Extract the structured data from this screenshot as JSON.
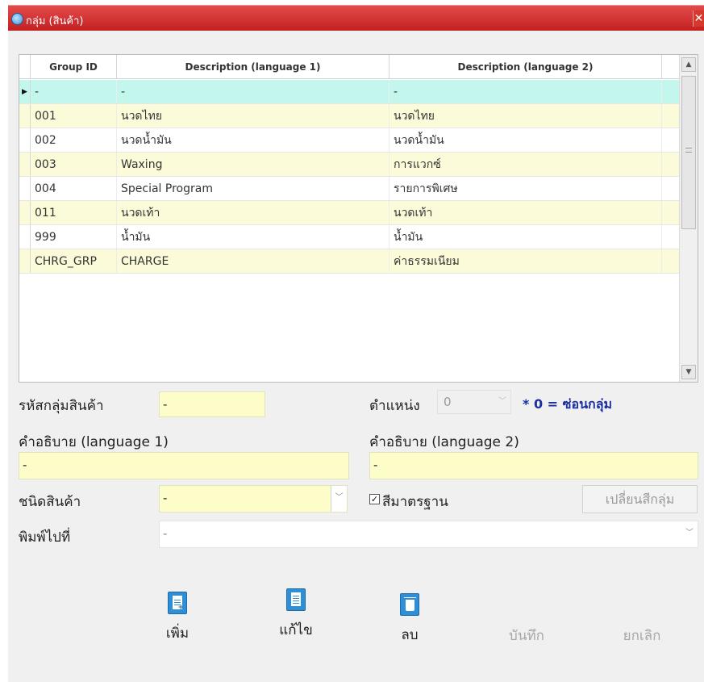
{
  "window": {
    "title": "กลุ่ม (สินค้า)",
    "close_glyph": "✕"
  },
  "grid": {
    "columns": [
      "Group ID",
      "Description (language 1)",
      "Description (language 2)"
    ],
    "current_marker": "▶",
    "rows": [
      {
        "id": "-",
        "d1": "-",
        "d2": "-"
      },
      {
        "id": "001",
        "d1": "นวดไทย",
        "d2": "นวดไทย"
      },
      {
        "id": "002",
        "d1": "นวดน้ำมัน",
        "d2": "นวดน้ำมัน"
      },
      {
        "id": "003",
        "d1": "Waxing",
        "d2": "การแวกซ์"
      },
      {
        "id": "004",
        "d1": "Special Program",
        "d2": "รายการพิเศษ"
      },
      {
        "id": "011",
        "d1": "นวดเท้า",
        "d2": "นวดเท้า"
      },
      {
        "id": "999",
        "d1": "น้ำมัน",
        "d2": "น้ำมัน"
      },
      {
        "id": "CHRG_GRP",
        "d1": "CHARGE",
        "d2": "ค่าธรรมเนียม"
      }
    ]
  },
  "form": {
    "group_code_label": "รหัสกลุ่มสินค้า",
    "group_code_value": "-",
    "position_label": "ตำแหน่ง",
    "position_value": "0",
    "position_note": "* 0 = ซ่อนกลุ่ม",
    "desc1_label": "คำอธิบาย (language 1)",
    "desc1_value": "-",
    "desc2_label": "คำอธิบาย (language 2)",
    "desc2_value": "-",
    "product_type_label": "ชนิดสินค้า",
    "product_type_value": "-",
    "standard_color_label": "สีมาตรฐาน",
    "standard_color_checked": true,
    "change_color_button": "เปลี่ยนสีกลุ่ม",
    "print_to_label": "พิมพ์ไปที่",
    "print_to_value": "-"
  },
  "toolbar": {
    "add": "เพิ่ม",
    "edit": "แก้ไข",
    "delete": "ลบ",
    "save": "บันทึก",
    "cancel": "ยกเลิก"
  }
}
